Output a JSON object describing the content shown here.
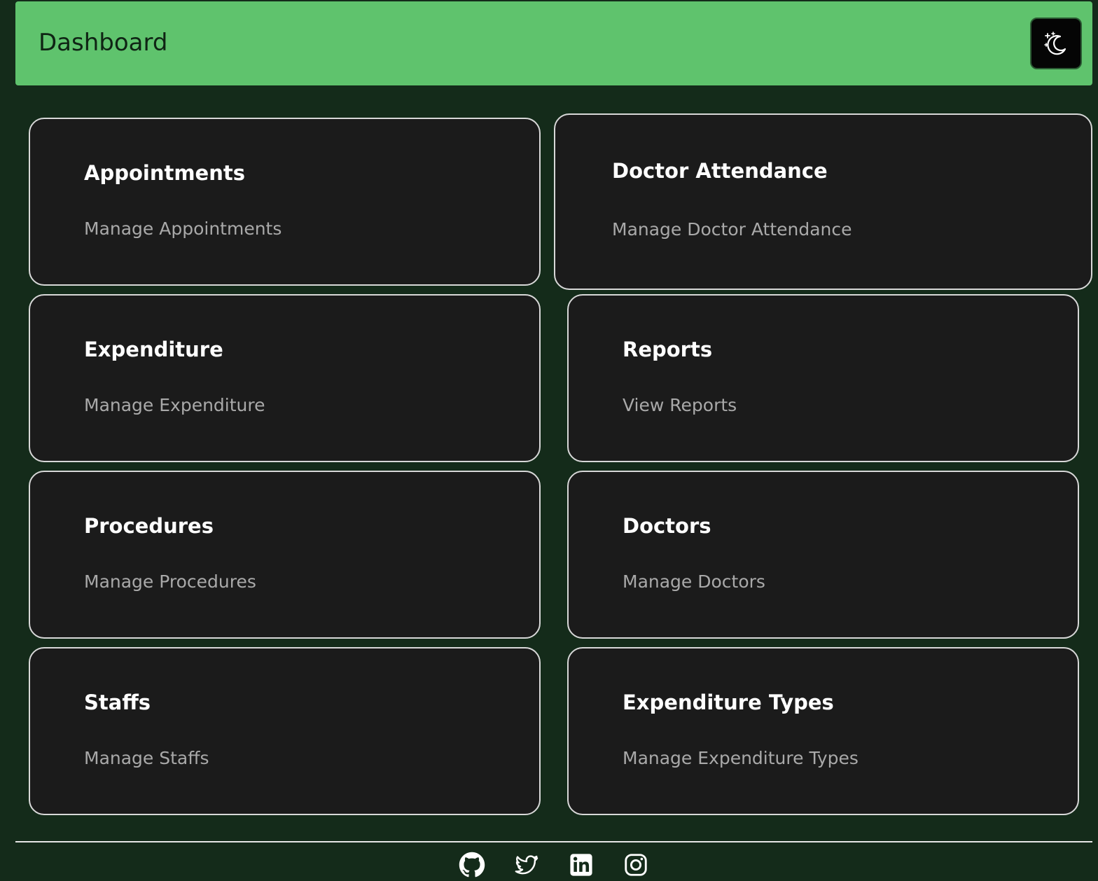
{
  "header": {
    "title": "Dashboard",
    "theme_toggle_icon": "moon-stars-icon",
    "background_color": "#5fc36d"
  },
  "cards": [
    {
      "title": "Appointments",
      "subtitle": "Manage Appointments"
    },
    {
      "title": "Doctor Attendance",
      "subtitle": "Manage Doctor Attendance"
    },
    {
      "title": "Expenditure",
      "subtitle": "Manage Expenditure"
    },
    {
      "title": "Reports",
      "subtitle": "View Reports"
    },
    {
      "title": "Procedures",
      "subtitle": "Manage Procedures"
    },
    {
      "title": "Doctors",
      "subtitle": "Manage Doctors"
    },
    {
      "title": "Staffs",
      "subtitle": "Manage Staffs"
    },
    {
      "title": "Expenditure Types",
      "subtitle": "Manage Expenditure Types"
    }
  ],
  "footer": {
    "social_icons": [
      "github-icon",
      "twitter-icon",
      "linkedin-icon",
      "instagram-icon"
    ]
  },
  "colors": {
    "page_background": "#142b1a",
    "card_background": "#1b1b1b",
    "card_border": "#d8d8d8"
  }
}
